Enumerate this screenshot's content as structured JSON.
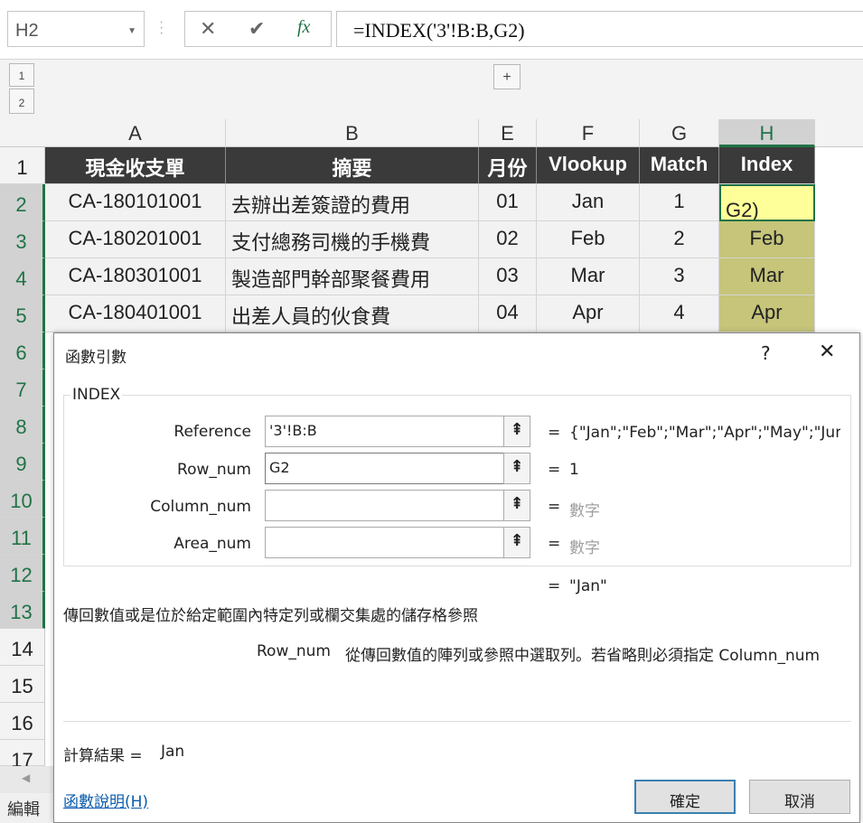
{
  "formula_bar": {
    "name_box": "H2",
    "cancel_icon": "✕",
    "enter_icon": "✔",
    "fx_label": "fx",
    "formula": "=INDEX('3'!B:B,G2)"
  },
  "outline": {
    "level1": "1",
    "level2": "2",
    "expand": "+"
  },
  "columns": [
    "A",
    "B",
    "E",
    "F",
    "G",
    "H"
  ],
  "rows": [
    "1",
    "2",
    "3",
    "4",
    "5",
    "6",
    "7",
    "8",
    "9",
    "10",
    "11",
    "12",
    "13",
    "14",
    "15",
    "16",
    "17"
  ],
  "table": {
    "headers": [
      "現金收支單",
      "摘要",
      "月份",
      "Vlookup",
      "Match",
      "Index"
    ],
    "data": [
      [
        "CA-180101001",
        "去辦出差簽證的費用",
        "01",
        "Jan",
        "1",
        "G2)"
      ],
      [
        "CA-180201001",
        "支付總務司機的手機費",
        "02",
        "Feb",
        "2",
        "Feb"
      ],
      [
        "CA-180301001",
        "製造部門幹部聚餐費用",
        "03",
        "Mar",
        "3",
        "Mar"
      ],
      [
        "CA-180401001",
        "出差人員的伙食費",
        "04",
        "Apr",
        "4",
        "Apr"
      ]
    ]
  },
  "dialog": {
    "title": "函數引數",
    "help": "?",
    "close": "✕",
    "function_name": "INDEX",
    "args": [
      {
        "label": "Reference",
        "value": "'3'!B:B",
        "result": "{\"Jan\";\"Feb\";\"Mar\";\"Apr\";\"May\";\"June"
      },
      {
        "label": "Row_num",
        "value": "G2",
        "result": "1"
      },
      {
        "label": "Column_num",
        "value": "",
        "result": "數字"
      },
      {
        "label": "Area_num",
        "value": "",
        "result": "數字"
      }
    ],
    "ref_icon": "⇞",
    "equals": "=",
    "formula_result": "\"Jan\"",
    "description": "傳回數值或是位於給定範圍內特定列或欄交集處的儲存格參照",
    "arg_name": "Row_num",
    "arg_desc": "從傳回數值的陣列或參照中選取列。若省略則必須指定 Column_num",
    "calc_label": "計算結果 =",
    "calc_value": "Jan",
    "help_link": "函數說明(H)",
    "ok": "確定",
    "cancel": "取消"
  },
  "status": {
    "mode": "編輯"
  }
}
